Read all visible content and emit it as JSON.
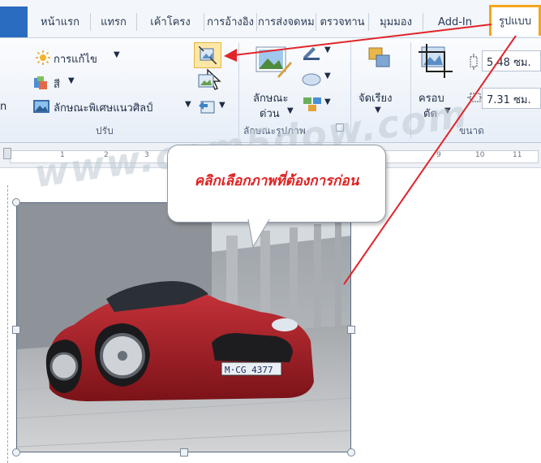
{
  "tabs": [
    "หน้าแรก",
    "แทรก",
    "เค้าโครง",
    "การอ้างอิง",
    "การส่งจดหมาย",
    "ตรวจทาน",
    "มุมมอง",
    "Add-In",
    "รูปแบบ"
  ],
  "adjust_group": {
    "corrections": "การแก้ไข",
    "color": "สี",
    "artistic": "ลักษณะพิเศษแนวศิลป์",
    "label": "ปรับ"
  },
  "styles_group": {
    "quick_styles_line1": "ลักษณะ",
    "quick_styles_line2": "ด่วน",
    "label": "ลักษณะรูปภาพ"
  },
  "arrange_group": {
    "arrange": "จัดเรียง"
  },
  "size_group": {
    "crop_line1": "ครอบ",
    "crop_line2": "ตัด",
    "height": "5.48 ซม.",
    "width": "7.31 ซม.",
    "label": "ขนาด"
  },
  "ruler_numbers": [
    "1",
    "2",
    "3",
    "9",
    "10",
    "11"
  ],
  "watermark": "www.com5dow.com",
  "callout": "คลิกเลือกภาพที่ต้องการก่อน",
  "car_plate": "M·CG 4377",
  "colors": {
    "accent_highlight": "#f4a51c",
    "arrow_red": "#e0252a",
    "callout_text": "#e02020"
  }
}
